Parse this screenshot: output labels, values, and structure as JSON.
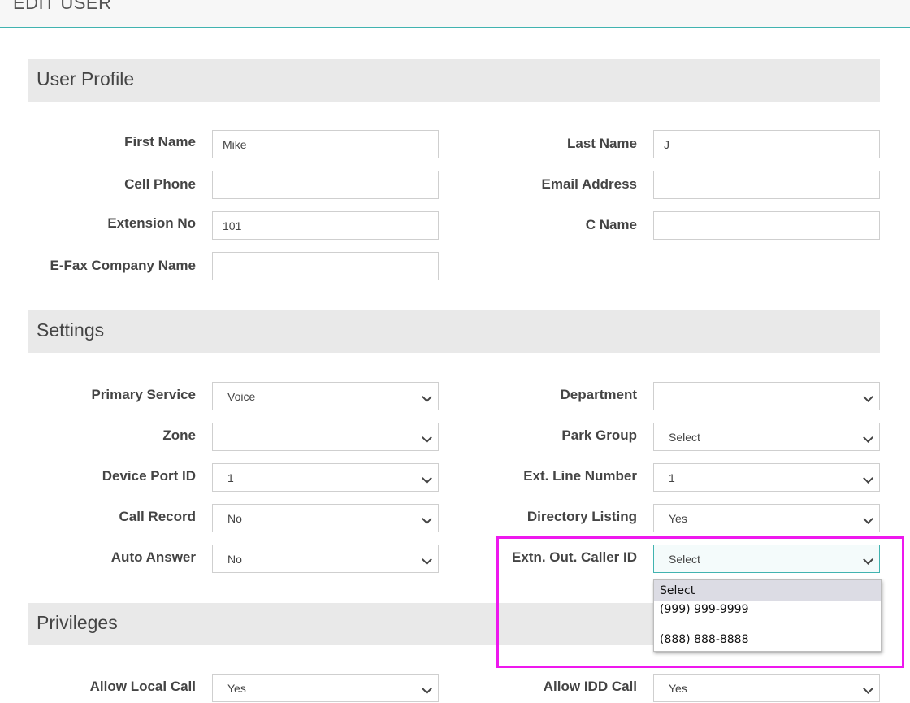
{
  "header": {
    "title": "EDIT USER"
  },
  "sections": {
    "profile": "User Profile",
    "settings": "Settings",
    "privileges": "Privileges"
  },
  "profile": {
    "first_name": {
      "label": "First Name",
      "value": "Mike"
    },
    "last_name": {
      "label": "Last Name",
      "value": "J"
    },
    "cell_phone": {
      "label": "Cell Phone",
      "value": ""
    },
    "email": {
      "label": "Email Address",
      "value": ""
    },
    "extension": {
      "label": "Extension No",
      "value": "101"
    },
    "c_name": {
      "label": "C Name",
      "value": ""
    },
    "efax": {
      "label": "E-Fax Company Name",
      "value": ""
    }
  },
  "settings": {
    "primary_service": {
      "label": "Primary Service",
      "value": "Voice"
    },
    "department": {
      "label": "Department",
      "value": ""
    },
    "zone": {
      "label": "Zone",
      "value": ""
    },
    "park_group": {
      "label": "Park Group",
      "value": "Select"
    },
    "device_port": {
      "label": "Device Port ID",
      "value": "1"
    },
    "ext_line": {
      "label": "Ext. Line Number",
      "value": "1"
    },
    "call_record": {
      "label": "Call Record",
      "value": "No"
    },
    "directory_listing": {
      "label": "Directory Listing",
      "value": "Yes"
    },
    "auto_answer": {
      "label": "Auto Answer",
      "value": "No"
    },
    "caller_id": {
      "label": "Extn. Out. Caller ID",
      "value": "Select",
      "options": [
        "Select",
        "(999) 999-9999",
        "(888) 888-8888"
      ]
    }
  },
  "privileges": {
    "local_call": {
      "label": "Allow Local Call",
      "value": "Yes"
    },
    "idd_call": {
      "label": "Allow IDD Call",
      "value": "Yes"
    }
  },
  "colors": {
    "accent": "#41b3b0",
    "highlight": "#ee18ee"
  }
}
